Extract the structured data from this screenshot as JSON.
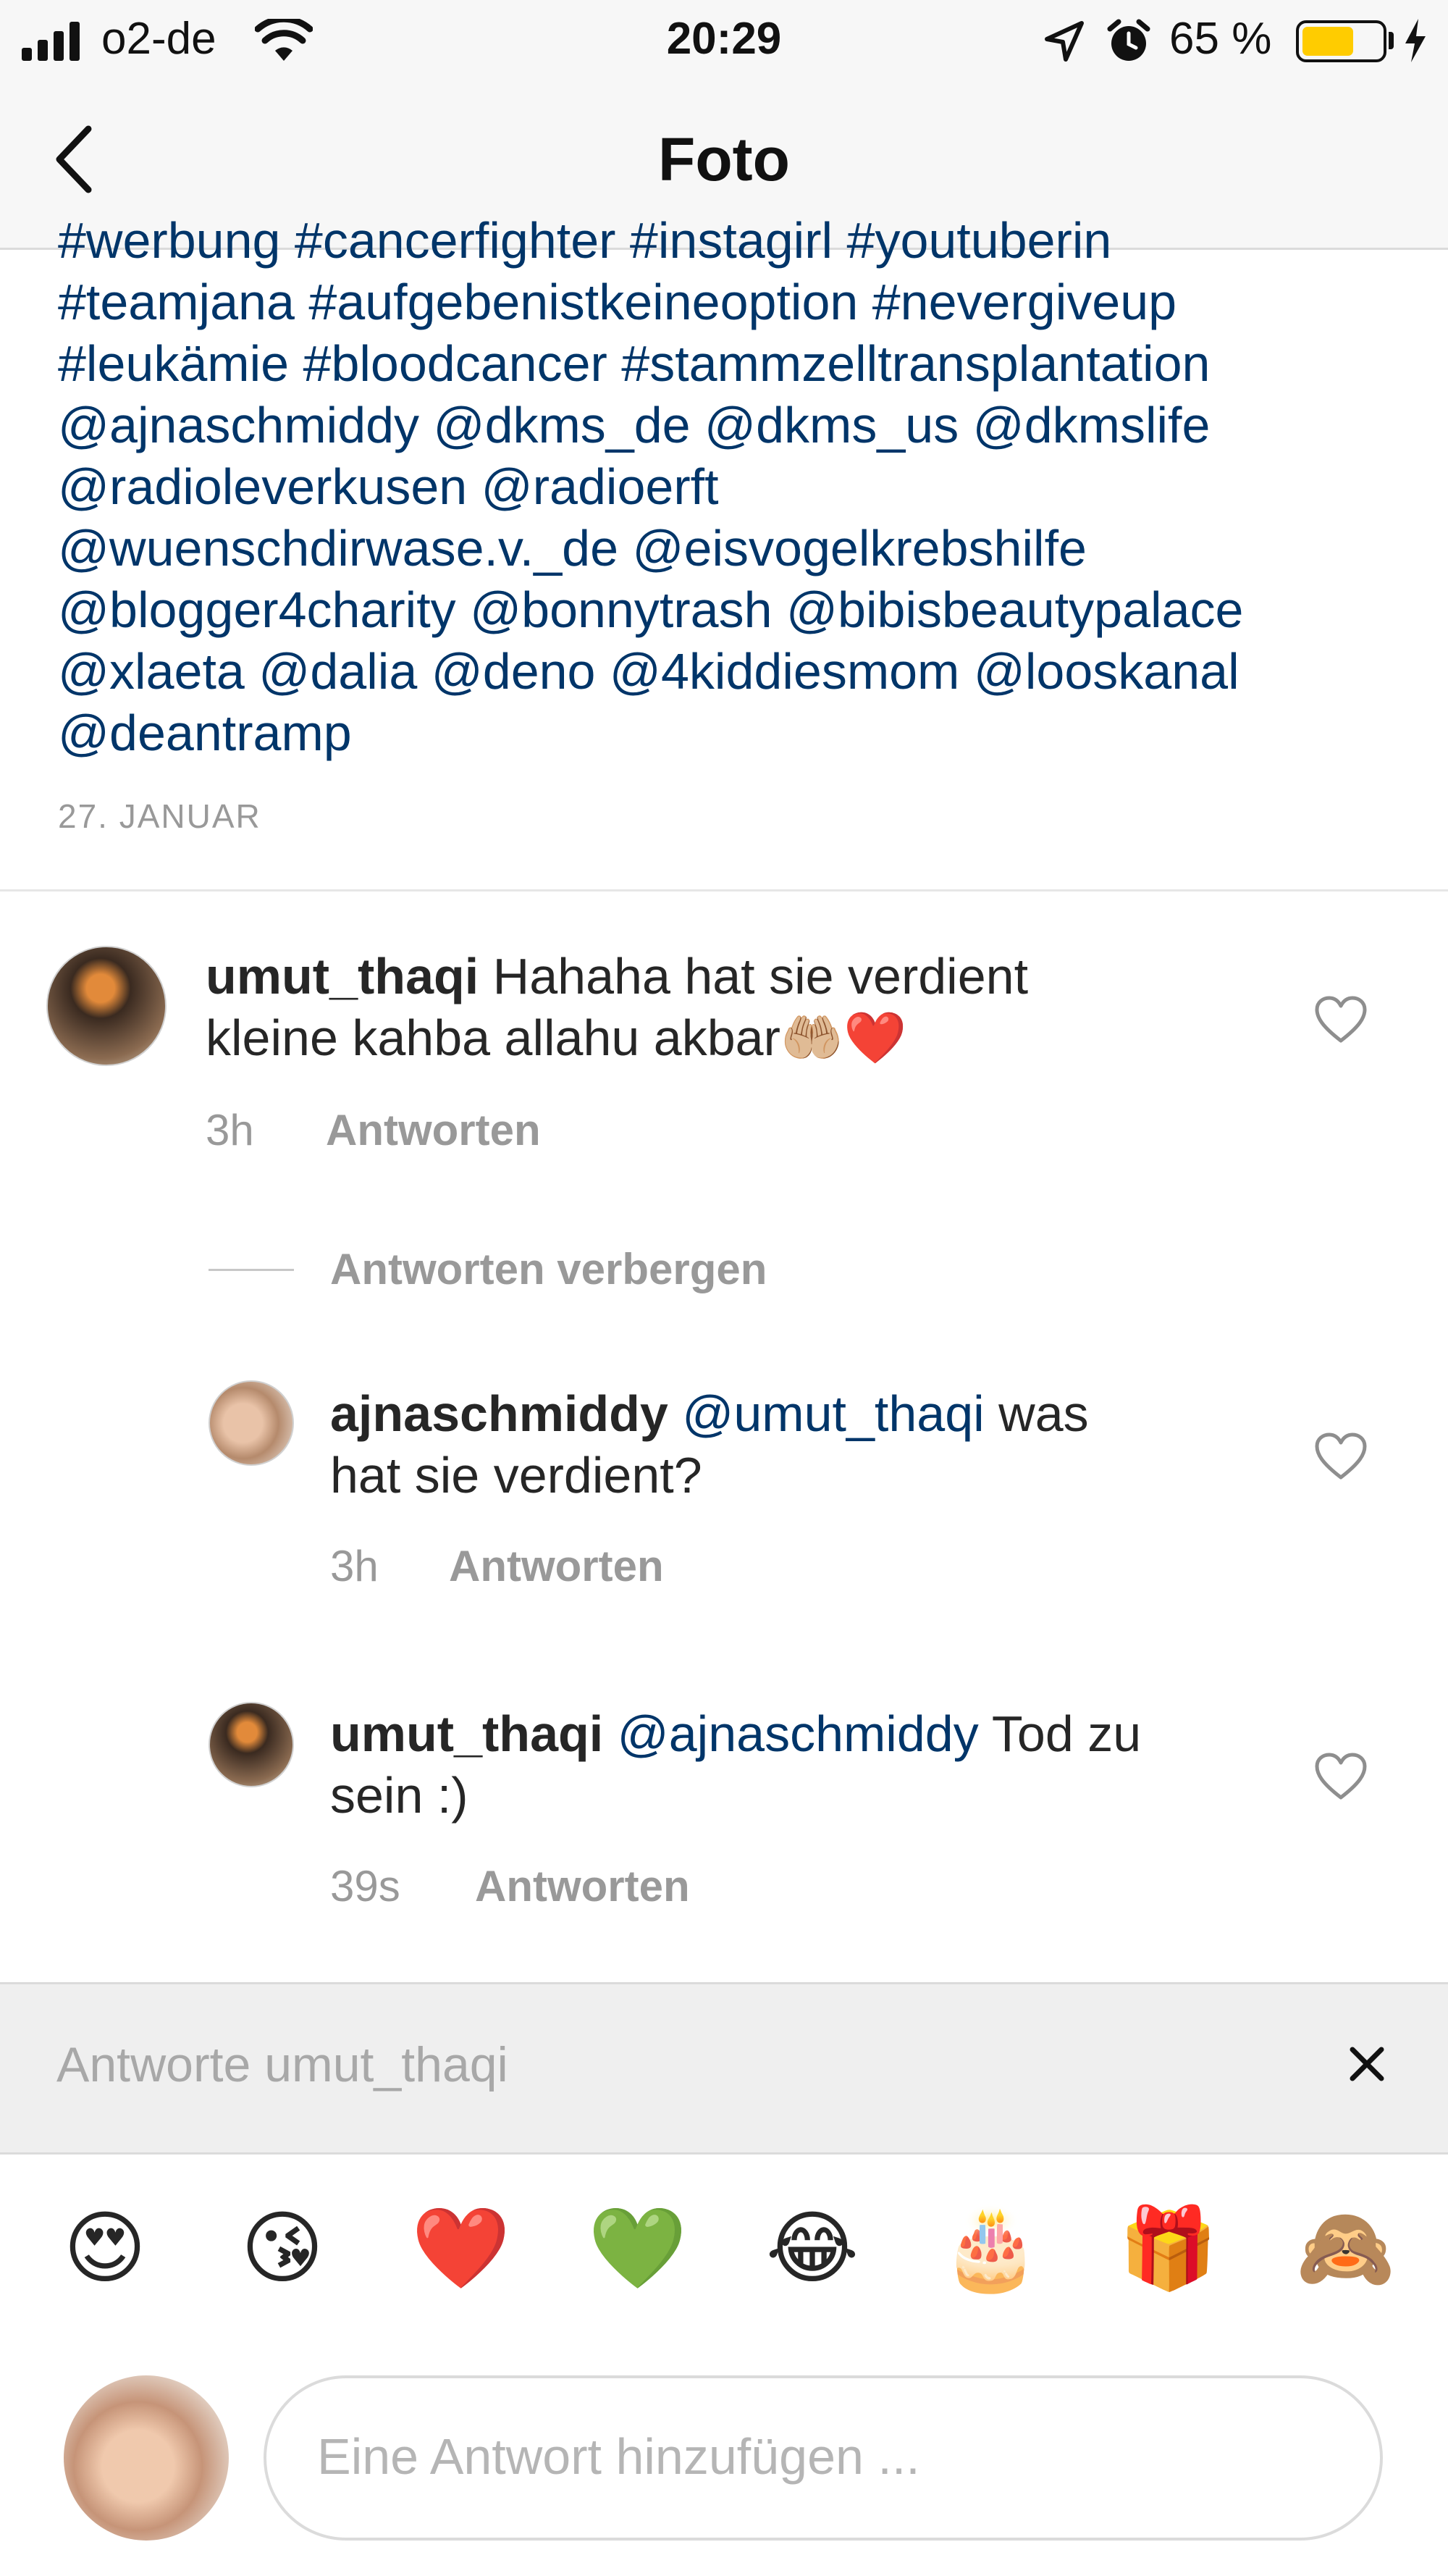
{
  "status_bar": {
    "carrier": "o2-de",
    "time": "20:29",
    "battery_percent": "65 %",
    "battery_level": 0.65,
    "icons": [
      "signal-icon",
      "wifi-icon",
      "location-arrow-icon",
      "alarm-icon",
      "battery-icon",
      "charging-bolt-icon"
    ]
  },
  "nav": {
    "title": "Foto",
    "back_icon": "chevron-left-icon"
  },
  "caption": {
    "text": "#werbung #cancerfighter #instagirl #youtuberin\n#teamjana #aufgebenistkeineoption #nevergiveup\n#leukämie #bloodcancer #stammzelltransplantation\n@ajnaschmiddy @dkms_de @dkms_us @dkmslife\n@radioleverkusen @radioerft\n@wuenschdirwase.v._de @eisvogelkrebshilfe\n@blogger4charity @bonnytrash @bibisbeautypalace\n@xlaeta  @dalia @deno @4kiddiesmom @looskanal\n@deantramp",
    "date": "27. JANUAR"
  },
  "comments": [
    {
      "username": "umut_thaqi",
      "mention": "",
      "text_line1": " Hahaha hat sie verdient",
      "text_line2": "kleine kahba allahu akbar🤲🏼❤️",
      "time": "3h",
      "reply_label": "Antworten"
    }
  ],
  "hide_replies_label": "Antworten verbergen",
  "replies": [
    {
      "username": "ajnaschmiddy",
      "mention": " @umut_thaqi",
      "text_line1": " was",
      "text_line2": "hat sie verdient?",
      "time": "3h",
      "reply_label": "Antworten"
    },
    {
      "username": "umut_thaqi",
      "mention": " @ajnaschmiddy",
      "text_line1": " Tod zu",
      "text_line2": "sein :)",
      "time": "39s",
      "reply_label": "Antworten"
    }
  ],
  "reply_bar": {
    "text": "Antworte umut_thaqi",
    "close_symbol": "×"
  },
  "emoji_bar": [
    "😍",
    "😘",
    "❤️",
    "💚",
    "😂",
    "🎂",
    "🎁",
    "🙈"
  ],
  "composer": {
    "placeholder": "Eine Antwort hinzufügen ..."
  },
  "colors": {
    "link": "#003569",
    "muted": "#999999",
    "bar_bg": "#f7f7f7",
    "reply_bar_bg": "#efefef"
  }
}
